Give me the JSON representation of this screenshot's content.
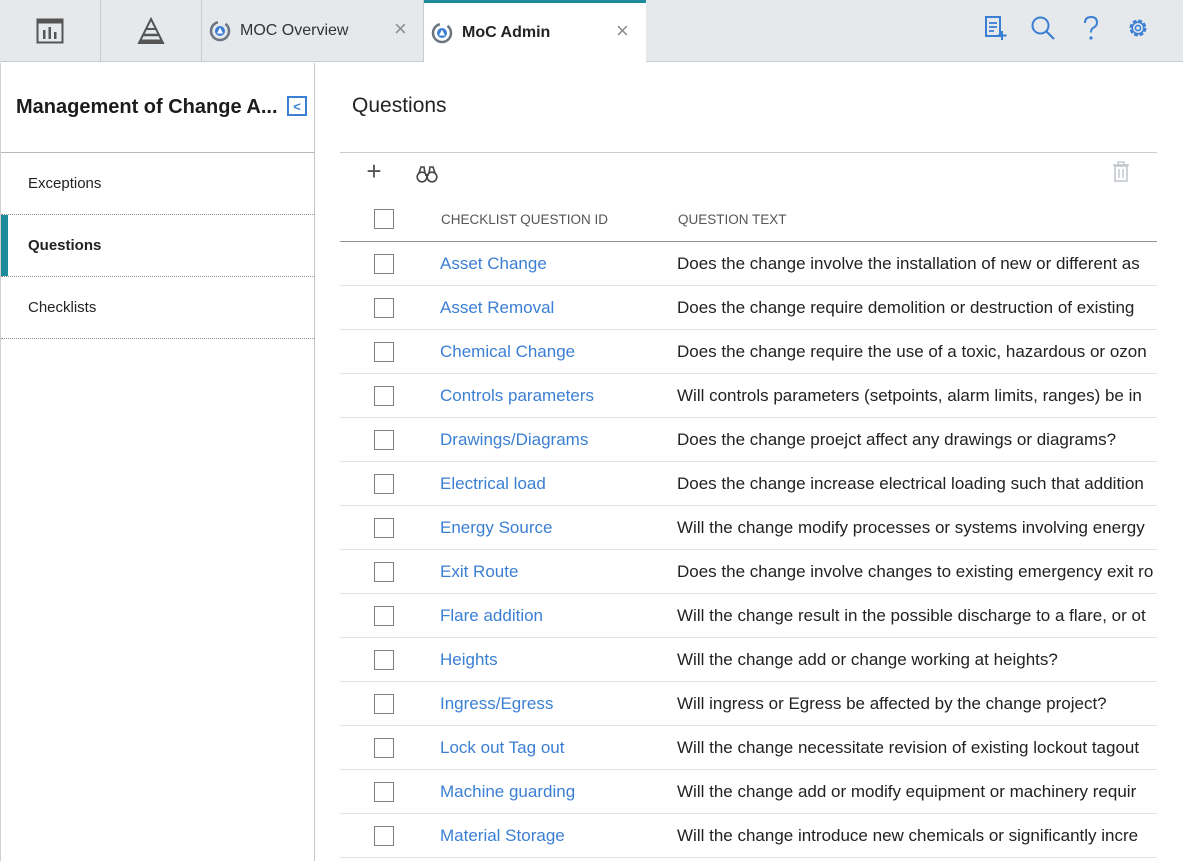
{
  "tabs": [
    {
      "label": "MOC Overview",
      "close": "×"
    },
    {
      "label": "MoC Admin",
      "close": "×"
    }
  ],
  "sidebar": {
    "title": "Management of Change A...",
    "collapse_glyph": "<",
    "items": [
      {
        "label": "Exceptions"
      },
      {
        "label": "Questions"
      },
      {
        "label": "Checklists"
      }
    ]
  },
  "main": {
    "title": "Questions",
    "add_glyph": "+",
    "columns": [
      "CHECKLIST QUESTION ID",
      "QUESTION TEXT"
    ],
    "rows": [
      {
        "id": "Asset Change",
        "text": "Does the change involve the installation of new or different as"
      },
      {
        "id": "Asset Removal",
        "text": "Does the change require demolition or destruction of existing"
      },
      {
        "id": "Chemical Change",
        "text": "Does the change require the use of a toxic, hazardous or ozon"
      },
      {
        "id": "Controls parameters",
        "text": "Will controls parameters (setpoints, alarm limits, ranges) be in"
      },
      {
        "id": "Drawings/Diagrams",
        "text": "Does the change proejct affect any drawings or diagrams?"
      },
      {
        "id": "Electrical load",
        "text": "Does the change increase electrical loading such that addition"
      },
      {
        "id": "Energy Source",
        "text": "Will the change modify processes or systems involving energy"
      },
      {
        "id": "Exit Route",
        "text": "Does the change involve changes to existing emergency exit ro"
      },
      {
        "id": "Flare addition",
        "text": "Will the change result in the possible discharge to a flare, or ot"
      },
      {
        "id": "Heights",
        "text": "Will the change add or change working at heights?"
      },
      {
        "id": "Ingress/Egress",
        "text": "Will ingress or Egress be affected by the change project?"
      },
      {
        "id": "Lock out Tag out",
        "text": "Will the change necessitate revision of existing lockout tagout"
      },
      {
        "id": "Machine guarding",
        "text": "Will the change add or modify equipment or machinery requir"
      },
      {
        "id": "Material Storage",
        "text": "Will the change introduce new chemicals or significantly incre"
      }
    ]
  },
  "colors": {
    "accent": "#1d8b9a",
    "link": "#3b7fd4"
  }
}
